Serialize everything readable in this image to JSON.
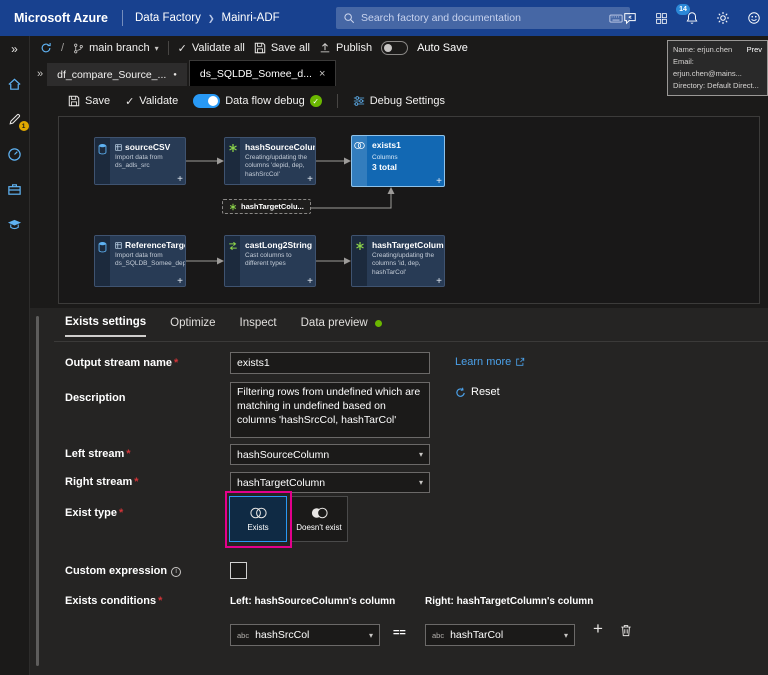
{
  "glyphs": {
    "required": "*",
    "plus": "+",
    "close": "×",
    "unsaved_dot": "●",
    "chevron_down": "▾",
    "collapse": "»",
    "check": "✓",
    "slash": "/",
    "crumb_sep": "❯",
    "info": "i"
  },
  "colors": {
    "topbar": "#18418f",
    "accent": "#4ba0e8",
    "toggle_on": "#2899f5",
    "success": "#6bb700",
    "annotation_highlight": "#e3008c",
    "author_badge": "#e0a800"
  },
  "header": {
    "brand": "Microsoft Azure",
    "crumb_section": "Data Factory",
    "crumb_item": "Mainri-ADF",
    "search_placeholder": "Search factory and documentation",
    "notification_badge": "14"
  },
  "cmdbar": {
    "branch_name": "main branch",
    "validate_all": "Validate all",
    "save_all": "Save all",
    "publish": "Publish",
    "auto_save": "Auto Save"
  },
  "user_card": {
    "name": "Name: erjun.chen",
    "preview": "Prev",
    "email": "Email: erjun.chen@mains...",
    "directory": "Directory: Default Direct..."
  },
  "tabs": {
    "tab1": "df_compare_Source_...",
    "tab2": "ds_SQLDB_Somee_d..."
  },
  "flowbar": {
    "save": "Save",
    "validate": "Validate",
    "debug": "Data flow debug",
    "debug_settings": "Debug Settings"
  },
  "canvas": {
    "nodes": [
      {
        "title": "sourceCSV",
        "subtitle": "Import data from ds_adls_src"
      },
      {
        "title": "hashSourceColumn",
        "subtitle": "Creating/updating the columns 'depid, dep, hashSrcCol'"
      },
      {
        "title": "exists1",
        "columns_label": "Columns",
        "columns_value": "3 total"
      },
      {
        "title": "hashTargetColu..."
      },
      {
        "title": "ReferenceTarget",
        "subtitle": "Import data from ds_SQLDB_Somee_depdw"
      },
      {
        "title": "castLong2String",
        "subtitle": "Cast columns to different types"
      },
      {
        "title": "hashTargetColumn",
        "subtitle": "Creating/updating the columns 'id, dep, hashTarCol'"
      }
    ]
  },
  "panel": {
    "tabs": {
      "settings": "Exists settings",
      "optimize": "Optimize",
      "inspect": "Inspect",
      "preview": "Data preview"
    },
    "fields": {
      "output_stream_label": "Output stream name",
      "output_stream_value": "exists1",
      "learn_more": "Learn more",
      "reset": "Reset",
      "description_label": "Description",
      "description_value": "Filtering rows from undefined which are matching in undefined based on columns 'hashSrcCol, hashTarCol'",
      "left_stream_label": "Left stream",
      "left_stream_value": "hashSourceColumn",
      "right_stream_label": "Right stream",
      "right_stream_value": "hashTargetColumn",
      "exist_type_label": "Exist type",
      "option_exists": "Exists",
      "option_doesnt": "Doesn't exist",
      "custom_expression_label": "Custom expression",
      "conditions_label": "Exists conditions",
      "left_header": "Left: hashSourceColumn's column",
      "right_header": "Right: hashTargetColumn's column",
      "type_tag": "abc",
      "left_condition": "hashSrcCol",
      "operator": "==",
      "right_condition": "hashTarCol"
    }
  }
}
